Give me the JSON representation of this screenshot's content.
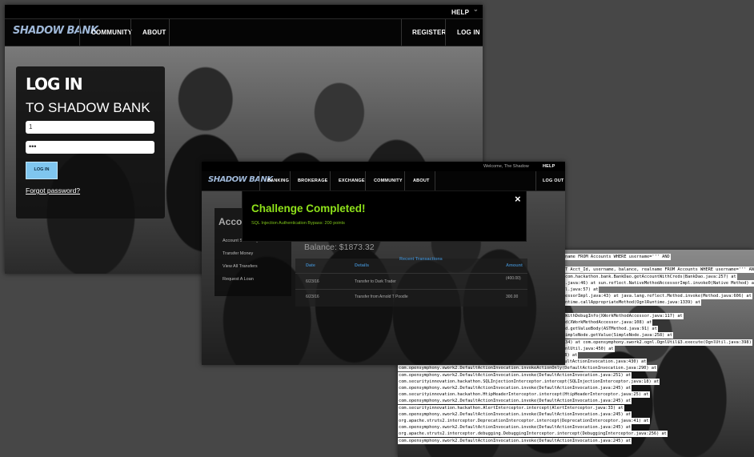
{
  "login_window": {
    "help_label": "HELP",
    "help_caret": "⌄",
    "logo": "SHADOW BANK",
    "nav_left": [
      "COMMUNITY",
      "ABOUT"
    ],
    "nav_right": [
      "REGISTER",
      "LOG IN"
    ],
    "heading": "LOG IN",
    "subheading": "TO SHADOW BANK",
    "username_value": "1",
    "password_value": "•••",
    "login_button": "LOG IN",
    "forgot_link": "Forgot password?"
  },
  "account_window": {
    "welcome": "Welcome, The Shadow",
    "help_label": "HELP",
    "logo": "SHADOW BANK",
    "nav": [
      "BANKING",
      "BROKERAGE",
      "EXCHANGE",
      "COMMUNITY",
      "ABOUT"
    ],
    "logout": "LOG OUT",
    "sidebar_title": "Accou",
    "sidebar_links": [
      "Account Summary",
      "Transfer Money",
      "View All Transfers",
      "Request A Loan"
    ],
    "balance": "Balance: $1873.32",
    "table_headers": [
      "Date",
      "Details",
      "Recent Transactions",
      "Amount"
    ],
    "rows": [
      {
        "date": "6/23/16",
        "details": "Transfer to Dark Trader",
        "amount": "(400.00)"
      },
      {
        "date": "6/23/16",
        "details": "Transfer from Arnold T Poodle",
        "amount": "300.00"
      }
    ],
    "modal_title": "Challenge Completed!",
    "modal_subtitle": "SQL Injection Authentication Bypass: 200 points",
    "modal_close": "×"
  },
  "stack_trace": {
    "lines": [
      "name FROM Accounts WHERE username=''' AND",
      "",
      "T Acct_Id, username, balance, realname FROM Accounts WHERE username=''' AN",
      "com.hackathon.bank.BankDao.getAccountWithCreds(BankDao.java:257) at",
      ".java:46) at sun.reflect.NativeMethodAccessorImpl.invoke0(Native Method) at",
      "l.java:57) at",
      "essorImpl.java:43) at java.lang.reflect.Method.invoke(Method.java:606) at",
      "ntime.callAppropriateMethod(OgnlRuntime.java:1339) at",
      "",
      "WithDebugInfo(XWorkMethodAccessor.java:117) at",
      "d(XWorkMethodAccessor.java:108) at",
      "d.getValueBody(ASTMethod.java:91) at",
      "impleNode.getValue(SimpleNode.java:258) at",
      "34) at com.opensymphony.xwork2.ognl.OgnlUtil$3.execute(OgnlUtil.java:398)",
      "nlUtil.java:450) at",
      "com.opensymphony.xwork2.ognl.OgnlUtil.callMethod(OgnlUtil.java:308) at",
      "com.opensymphony.xwork2.DefaultActionInvocation.invokeAction(DefaultActionInvocation.java:430) at",
      "com.opensymphony.xwork2.DefaultActionInvocation.invokeActionOnly(DefaultActionInvocation.java:290) at",
      "com.opensymphony.xwork2.DefaultActionInvocation.invoke(DefaultActionInvocation.java:251) at",
      "com.securityinnovation.hackathon.SQLInjectionInterceptor.intercept(SQLInjectionInterceptor.java:18) at",
      "com.opensymphony.xwork2.DefaultActionInvocation.invoke(DefaultActionInvocation.java:245) at",
      "com.securityinnovation.hackathon.HtipHeaderInterceptor.intercept(HtipHeaderInterceptor.java:25) at",
      "com.opensymphony.xwork2.DefaultActionInvocation.invoke(DefaultActionInvocation.java:245) at",
      "com.securityinnovation.hackathon.AlertInterceptor.intercept(AlertInterceptor.java:33) at",
      "com.opensymphony.xwork2.DefaultActionInvocation.invoke(DefaultActionInvocation.java:245) at",
      "org.apache.struts2.interceptor.DeprecationInterceptor.intercept(DeprecationInterceptor.java:41) at",
      "com.opensymphony.xwork2.DefaultActionInvocation.invoke(DefaultActionInvocation.java:245) at",
      "org.apache.struts2.interceptor.debugging.DebuggingInterceptor.intercept(DebuggingInterceptor.java:256) at",
      "com.opensymphony.xwork2.DefaultActionInvocation.invoke(DefaultActionInvocation.java:245) at"
    ]
  },
  "colors": {
    "modal_title": "#8fe21a",
    "modal_subtitle": "#7fc41a",
    "login_button_bg": "#7fc6ef",
    "table_header": "#3d7fb6",
    "background": "#474747"
  }
}
